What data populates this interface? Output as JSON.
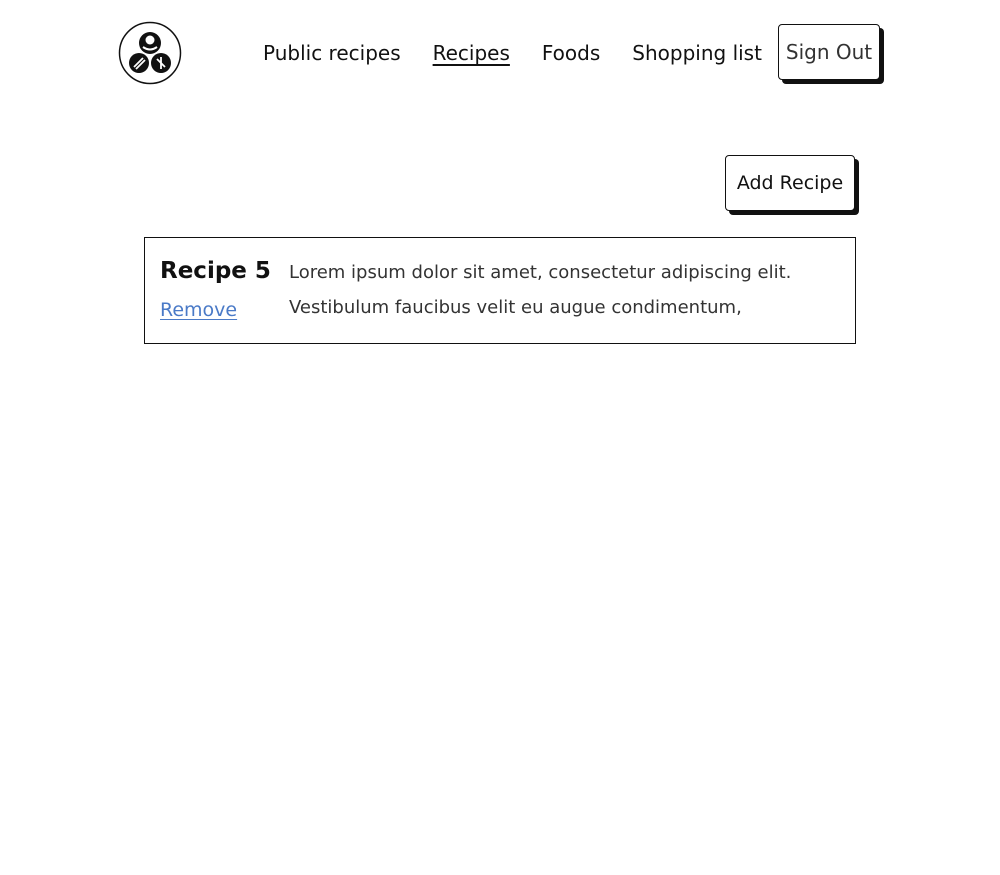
{
  "header": {
    "nav": [
      {
        "label": "Public recipes",
        "active": false
      },
      {
        "label": "Recipes",
        "active": true
      },
      {
        "label": "Foods",
        "active": false
      },
      {
        "label": "Shopping list",
        "active": false
      }
    ],
    "signout_label": "Sign Out"
  },
  "main": {
    "add_recipe_label": "Add Recipe",
    "recipes": [
      {
        "title": "Recipe 5",
        "remove_label": "Remove",
        "description": "Lorem ipsum dolor sit amet, consectetur adipiscing elit. Vestibulum faucibus velit eu augue condimentum,"
      }
    ]
  },
  "colors": {
    "text": "#111111",
    "muted_text": "#333333",
    "link": "#4a7ac7",
    "shadow": "#111111",
    "background": "#ffffff"
  }
}
